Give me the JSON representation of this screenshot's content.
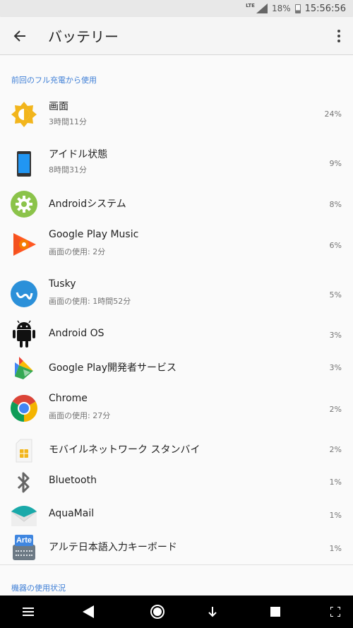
{
  "status_bar": {
    "network": "LTE",
    "battery_percent": "18%",
    "time": "15:56:56"
  },
  "app_bar": {
    "title": "バッテリー"
  },
  "section_since_charge": {
    "title": "前回のフル充電から使用"
  },
  "items": [
    {
      "name": "画面",
      "sub": "3時間11分",
      "pct": "24%",
      "icon": "brightness-icon"
    },
    {
      "name": "アイドル状態",
      "sub": "8時間31分",
      "pct": "9%",
      "icon": "phone-idle-icon"
    },
    {
      "name": "Androidシステム",
      "sub": "",
      "pct": "8%",
      "icon": "android-system-gear-icon"
    },
    {
      "name": "Google Play Music",
      "sub": "画面の使用: 2分",
      "pct": "6%",
      "icon": "google-play-music-icon"
    },
    {
      "name": "Tusky",
      "sub": "画面の使用: 1時間52分",
      "pct": "5%",
      "icon": "tusky-icon"
    },
    {
      "name": "Android OS",
      "sub": "",
      "pct": "3%",
      "icon": "android-robot-icon"
    },
    {
      "name": "Google Play開発者サービス",
      "sub": "",
      "pct": "3%",
      "icon": "google-play-services-icon"
    },
    {
      "name": "Chrome",
      "sub": "画面の使用: 27分",
      "pct": "2%",
      "icon": "chrome-icon"
    },
    {
      "name": "モバイルネットワーク スタンバイ",
      "sub": "",
      "pct": "2%",
      "icon": "sim-card-icon"
    },
    {
      "name": "Bluetooth",
      "sub": "",
      "pct": "1%",
      "icon": "bluetooth-icon"
    },
    {
      "name": "AquaMail",
      "sub": "",
      "pct": "1%",
      "icon": "aquamail-icon"
    },
    {
      "name": "アルテ日本語入力キーボード",
      "sub": "",
      "pct": "1%",
      "icon": "arte-keyboard-icon",
      "badge": "Arte"
    }
  ],
  "section_usage": {
    "title": "機器の使用状況"
  },
  "colors": {
    "accent": "#3f7fd6",
    "brightness": "#f2b51c",
    "android_green": "#8bc34a",
    "tusky_blue": "#2b90d9",
    "aquamail_teal": "#1aa9a9"
  }
}
